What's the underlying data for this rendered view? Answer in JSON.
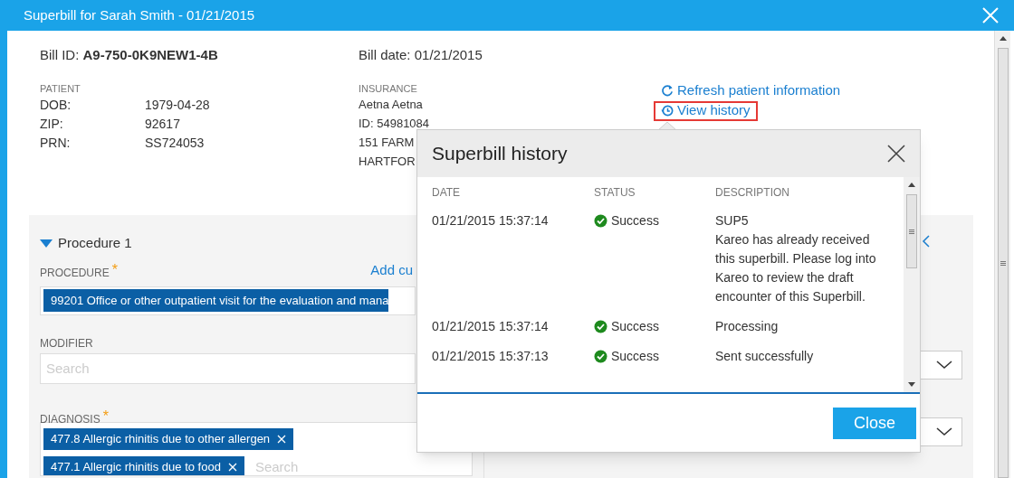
{
  "window": {
    "title": "Superbill for Sarah Smith - 01/21/2015"
  },
  "bill": {
    "id": "Bill ID: **A9-750-0K9NEW1-4B**",
    "date": "Bill date: 01/21/2015"
  },
  "patient": {
    "heading": "PATIENT",
    "fields": [
      {
        "label": "DOB:",
        "value": "1979-04-28"
      },
      {
        "label": "ZIP:",
        "value": "92617"
      },
      {
        "label": "PRN:",
        "value": "SS724053"
      }
    ]
  },
  "insurance": {
    "heading": "INSURANCE",
    "lines": [
      "Aetna Aetna",
      "ID: 54981084",
      "151 FARM",
      "HARTFOR"
    ]
  },
  "links": [
    {
      "kind": "refresh",
      "label": "Refresh patient information",
      "highlighted": false
    },
    {
      "kind": "history",
      "label": "View history",
      "highlighted": true
    }
  ],
  "procedure": {
    "title": "Procedure 1",
    "expanded": true,
    "procedure_label": "PROCEDURE",
    "procedure_required_mark": "*",
    "add_link": "Add cu",
    "procedure_tag": "99201 Office or other outpatient visit for the evaluation and mana",
    "modifier_label": "MODIFIER",
    "modifier_placeholder": "Search",
    "diagnosis_label": "DIAGNOSIS",
    "diagnosis_required_mark": "*",
    "diagnosis_tags": [
      "477.8 Allergic rhinitis due to other allergen",
      "477.1 Allergic rhinitis due to food"
    ],
    "diagnosis_placeholder": "Search"
  },
  "history": {
    "title": "Superbill history",
    "columns": [
      "DATE",
      "STATUS",
      "DESCRIPTION"
    ],
    "rows": [
      {
        "date": "01/21/2015 15:37:14",
        "kind": "success",
        "status_label": "Success",
        "description": [
          "SUP5",
          "Kareo has already received this superbill. Please log into Kareo to review the draft encounter of this Superbill."
        ]
      },
      {
        "date": "01/21/2015 15:37:14",
        "kind": "success",
        "status_label": "Success",
        "description": [
          "Processing"
        ]
      },
      {
        "date": "01/21/2015 15:37:13",
        "kind": "success",
        "status_label": "Success",
        "description": [
          "Sent successfully"
        ]
      }
    ],
    "close_button": "Close"
  }
}
